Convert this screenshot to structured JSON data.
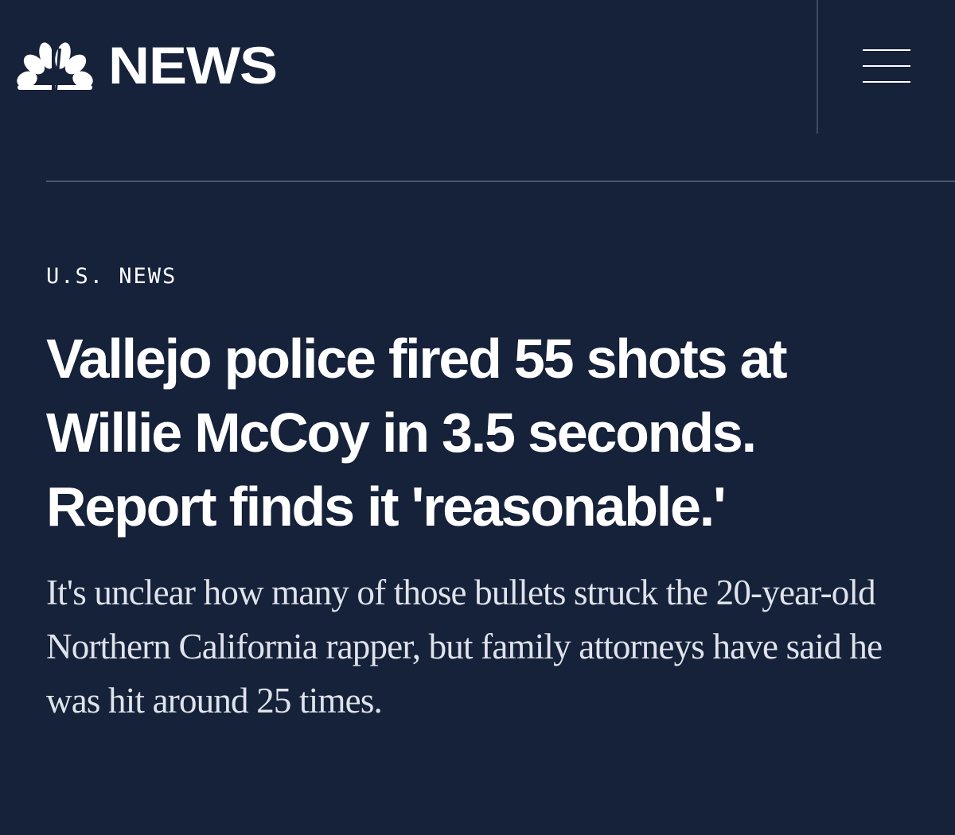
{
  "header": {
    "logo_text": "NEWS",
    "logo_icon": "peacock-icon",
    "menu_icon": "hamburger-menu-icon"
  },
  "article": {
    "section": "U.S. NEWS",
    "headline": "Vallejo police fired 55 shots at Willie McCoy in 3.5 seconds. Report finds it 'reasonable.'",
    "deck": "It's unclear how many of those bullets struck the 20-year-old Northern California rapper, but family attorneys have said he was hit around 25 times."
  },
  "colors": {
    "background": "#16213a",
    "text": "#ffffff",
    "deck_text": "#dfe3ea",
    "divider": "#4a5670"
  }
}
